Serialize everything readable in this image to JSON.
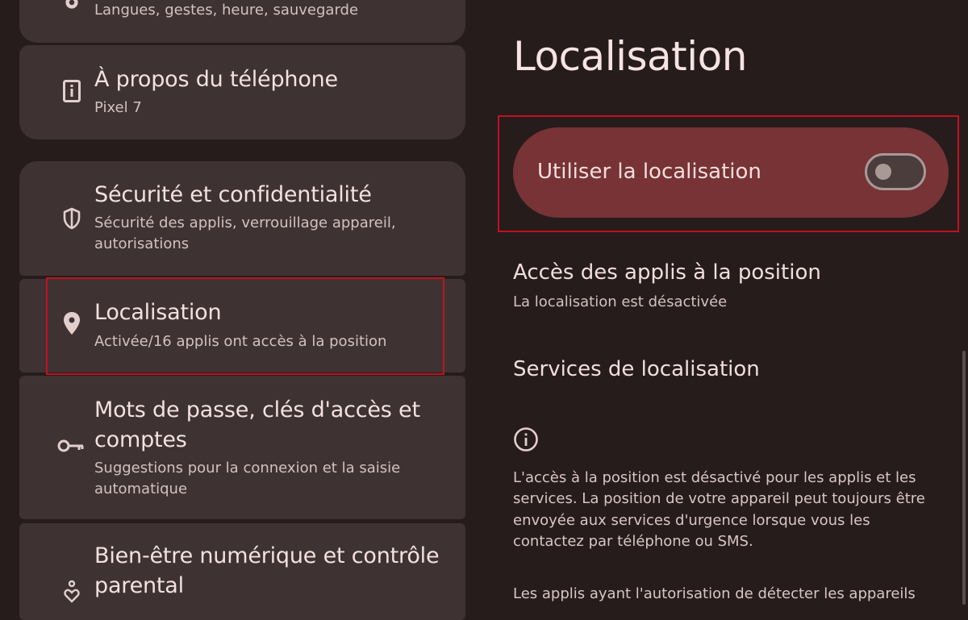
{
  "left_menu": {
    "items": [
      {
        "id": "system",
        "icon": "gear-icon",
        "title": "",
        "subtitle": "Langues, gestes, heure, sauvegarde"
      },
      {
        "id": "about",
        "icon": "phone-info-icon",
        "title": "À propos du téléphone",
        "subtitle": "Pixel 7"
      },
      {
        "id": "security",
        "icon": "shield-icon",
        "title": "Sécurité et confidentialité",
        "subtitle": "Sécurité des applis, verrouillage appareil, autorisations"
      },
      {
        "id": "location",
        "icon": "location-pin-icon",
        "title": "Localisation",
        "subtitle": "Activée/16 applis ont accès à la position"
      },
      {
        "id": "passwords",
        "icon": "key-icon",
        "title": "Mots de passe, clés d'accès et comptes",
        "subtitle": "Suggestions pour la connexion et la saisie automatique"
      },
      {
        "id": "wellbeing",
        "icon": "wellbeing-icon",
        "title": "Bien-être numérique et contrôle parental",
        "subtitle": ""
      }
    ]
  },
  "detail": {
    "title": "Localisation",
    "toggle": {
      "label": "Utiliser la localisation",
      "checked": false
    },
    "app_access": {
      "title": "Accès des applis à la position",
      "subtitle": "La localisation est désactivée"
    },
    "services": {
      "title": "Services de localisation"
    },
    "info_icon": "info-icon",
    "info_text": "L'accès à la position est désactivé pour les applis et les services. La position de votre appareil peut toujours être envoyée aux services d'urgence lorsque vous les contactez par téléphone ou SMS.",
    "info_text_2": "Les applis ayant l'autorisation de détecter les appareils"
  },
  "colors": {
    "background": "#261c1c",
    "card": "#3e3332",
    "accent_card": "#773335",
    "highlight": "#c4101f"
  }
}
